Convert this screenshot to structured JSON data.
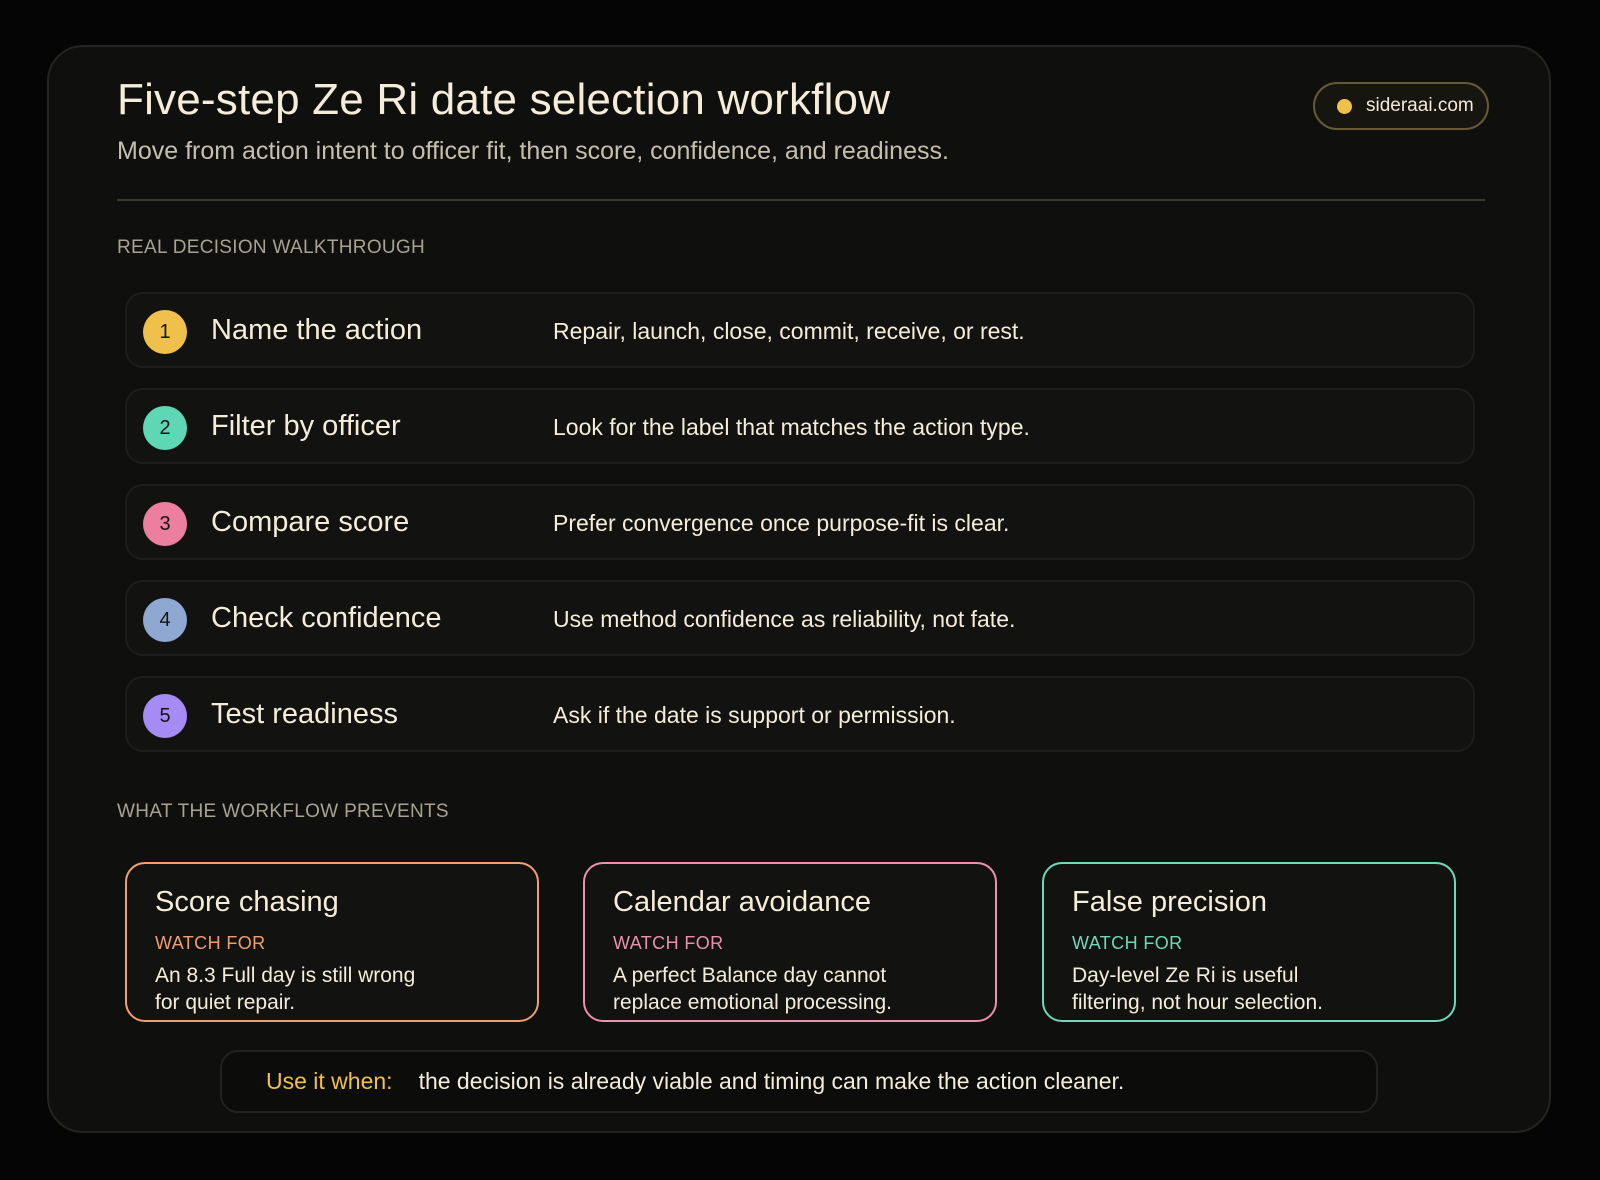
{
  "header": {
    "title": "Five-step Ze Ri date selection workflow",
    "subtitle": "Move from action intent to officer fit, then score, confidence, and readiness.",
    "badge_text": "sideraai.com",
    "badge_dot_color": "#f0c14a"
  },
  "walkthrough": {
    "label": "REAL DECISION WALKTHROUGH",
    "steps": [
      {
        "num": "1",
        "title": "Name the action",
        "desc": "Repair, launch, close, commit, receive, or rest.",
        "color": "#f0c14a"
      },
      {
        "num": "2",
        "title": "Filter by officer",
        "desc": "Look for the label that matches the action type.",
        "color": "#5fd6b4"
      },
      {
        "num": "3",
        "title": "Compare score",
        "desc": "Prefer convergence once purpose-fit is clear.",
        "color": "#ec7fa0"
      },
      {
        "num": "4",
        "title": "Check confidence",
        "desc": "Use method confidence as reliability, not fate.",
        "color": "#8ea8d2"
      },
      {
        "num": "5",
        "title": "Test readiness",
        "desc": "Ask if the date is support or permission.",
        "color": "#a78bf4"
      }
    ]
  },
  "prevents": {
    "label": "WHAT THE WORKFLOW PREVENTS",
    "cards": [
      {
        "title": "Score chasing",
        "watch": "WATCH FOR",
        "line1": "An 8.3 Full day is still wrong",
        "line2": "for quiet repair.",
        "color": "#f0a070"
      },
      {
        "title": "Calendar avoidance",
        "watch": "WATCH FOR",
        "line1": "A perfect Balance day cannot",
        "line2": "replace emotional processing.",
        "color": "#ec8fb0"
      },
      {
        "title": "False precision",
        "watch": "WATCH FOR",
        "line1": "Day-level Ze Ri is useful",
        "line2": "filtering, not hour selection.",
        "color": "#6fd8bb"
      }
    ]
  },
  "use_when": {
    "label": "Use it when:",
    "text": "the decision is already viable and timing can make the action cleaner."
  }
}
